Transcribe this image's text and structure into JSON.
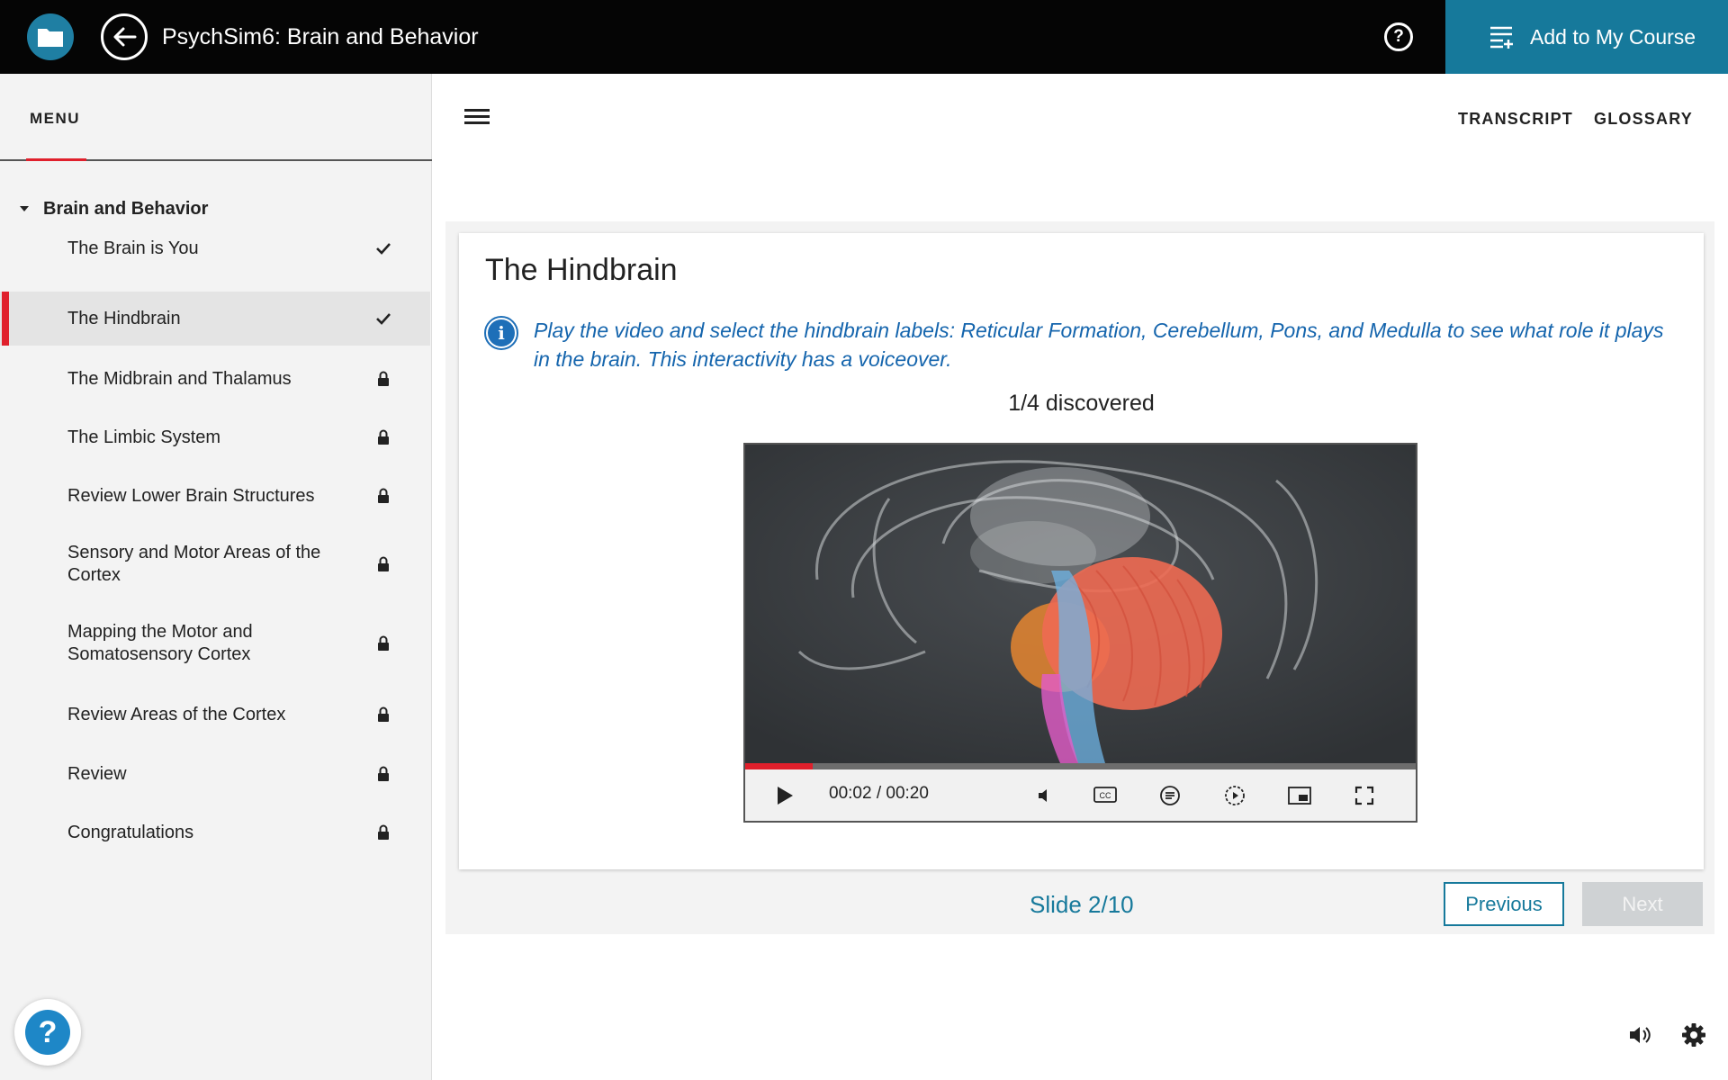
{
  "header": {
    "title": "PsychSim6: Brain and Behavior",
    "add_course_label": "Add to My Course",
    "brand_color": "#16799b"
  },
  "sidebar": {
    "menu_label": "MENU",
    "section_label": "Brain and Behavior",
    "items": [
      {
        "label": "The Brain is You",
        "status": "check-icon"
      },
      {
        "label": "The Hindbrain",
        "status": "check-icon",
        "active": true
      },
      {
        "label": "The Midbrain and Thalamus",
        "status": "lock-icon"
      },
      {
        "label": "The Limbic System",
        "status": "lock-icon"
      },
      {
        "label": "Review Lower Brain Structures",
        "status": "lock-icon"
      },
      {
        "label": "Sensory and Motor Areas of the Cortex",
        "status": "lock-icon"
      },
      {
        "label": "Mapping the Motor and Somatosensory Cortex",
        "status": "lock-icon"
      },
      {
        "label": "Review Areas of the Cortex",
        "status": "lock-icon"
      },
      {
        "label": "Review",
        "status": "lock-icon"
      },
      {
        "label": "Congratulations",
        "status": "lock-icon"
      }
    ],
    "accent_color": "#e0202c"
  },
  "toolbar": {
    "transcript_label": "TRANSCRIPT",
    "glossary_label": "GLOSSARY"
  },
  "slide": {
    "title": "The Hindbrain",
    "instructions": "Play the video and select the hindbrain labels: Reticular Formation, Cerebellum, Pons, and Medulla to see what role it plays in the brain. This interactivity has a voiceover.",
    "discovered": "1/4 discovered",
    "video": {
      "time": "00:02 / 00:20",
      "progress": 0.1
    },
    "slide_label": "Slide 2/10",
    "previous_label": "Previous",
    "next_label": "Next"
  }
}
